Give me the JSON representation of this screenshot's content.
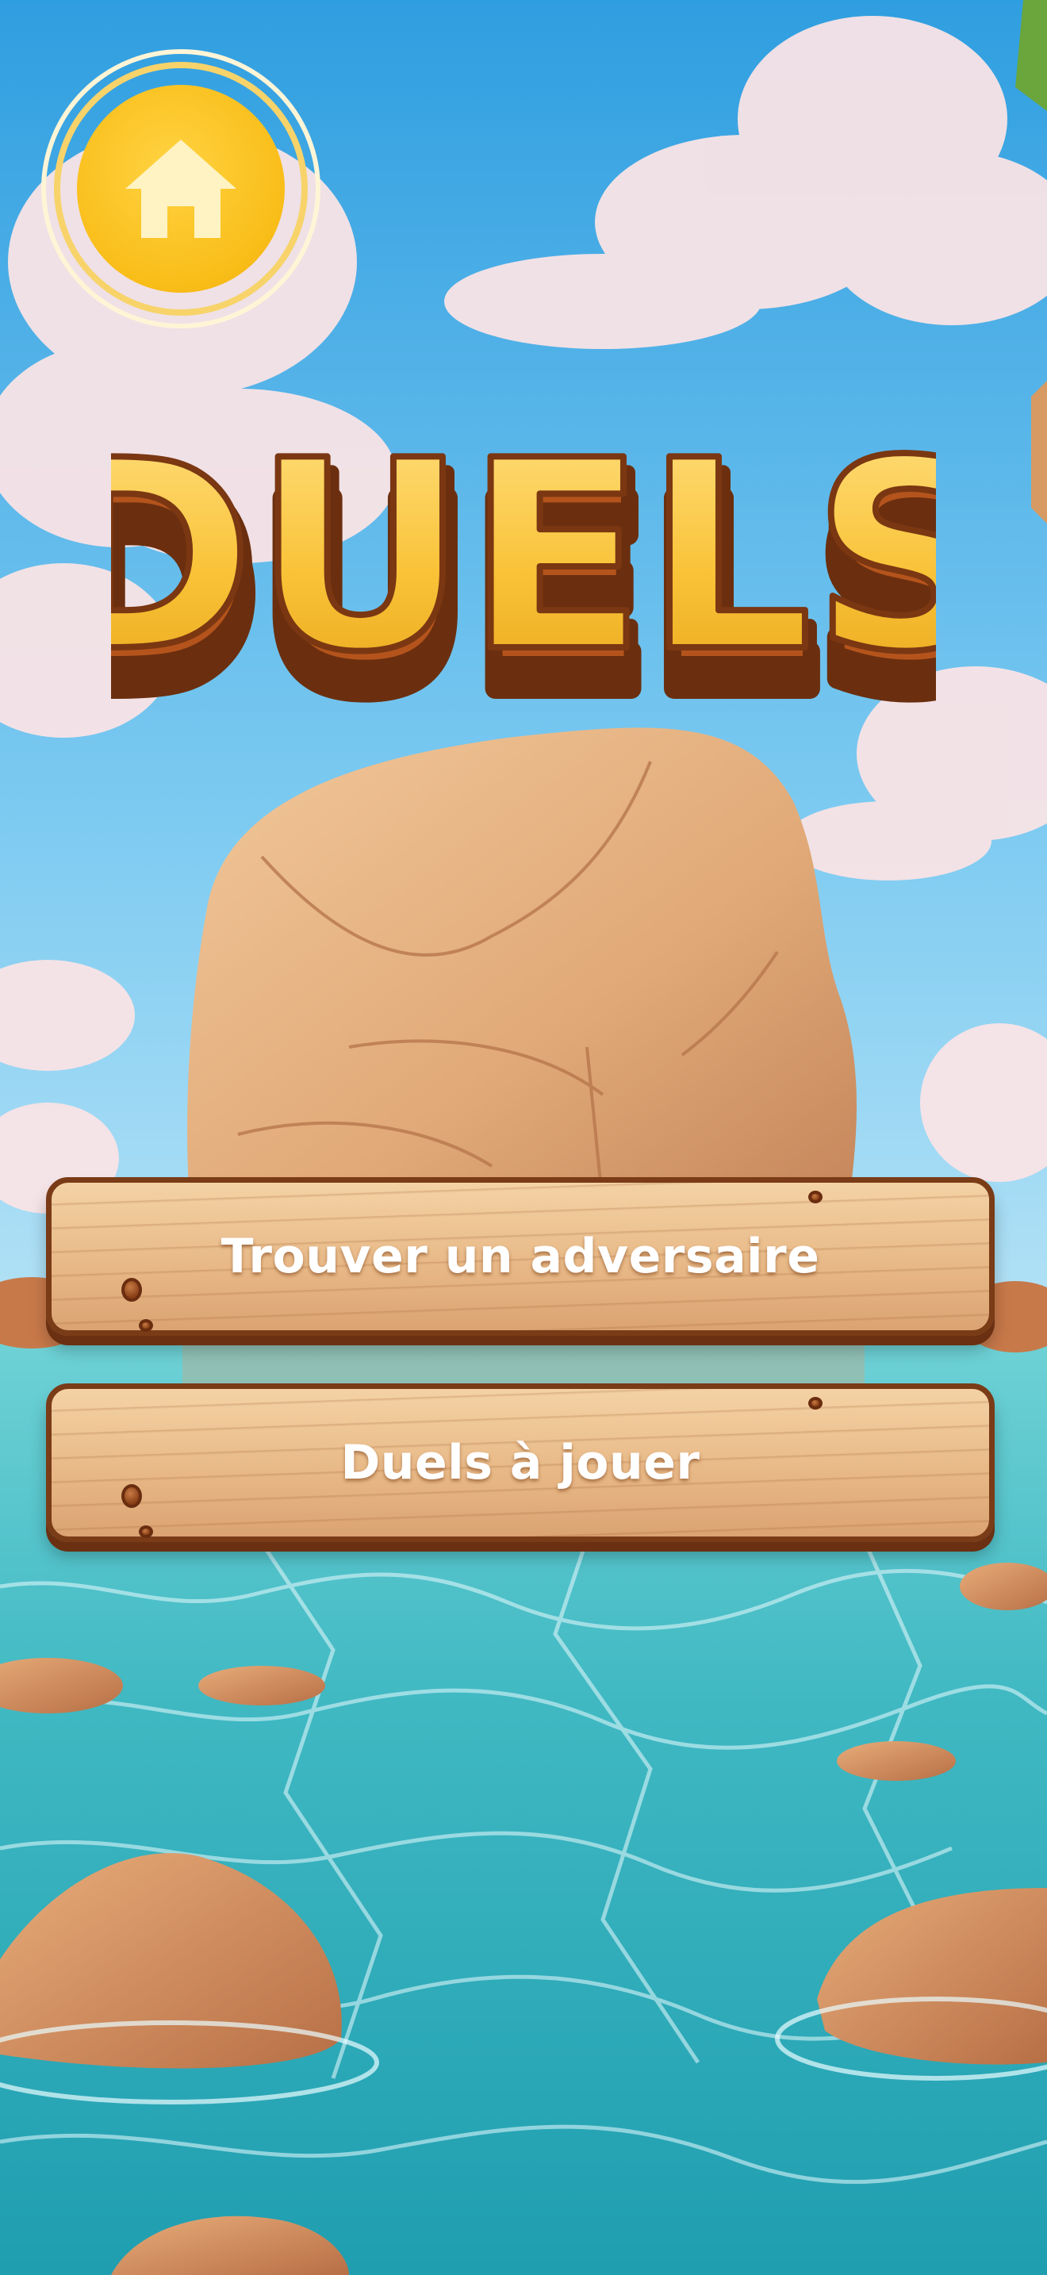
{
  "screen": {
    "title": "DUELS"
  },
  "home": {
    "icon": "home-icon"
  },
  "menu": {
    "find_opponent_label": "Trouver un adversaire",
    "pending_duels_label": "Duels à jouer"
  },
  "colors": {
    "title_fill": "#f7c13c",
    "title_outline": "#6b2f0f",
    "home_button": "#f9bd18",
    "plank_border": "#7a3b17",
    "sky": "#3fa6e2",
    "water": "#3ab9c0"
  }
}
